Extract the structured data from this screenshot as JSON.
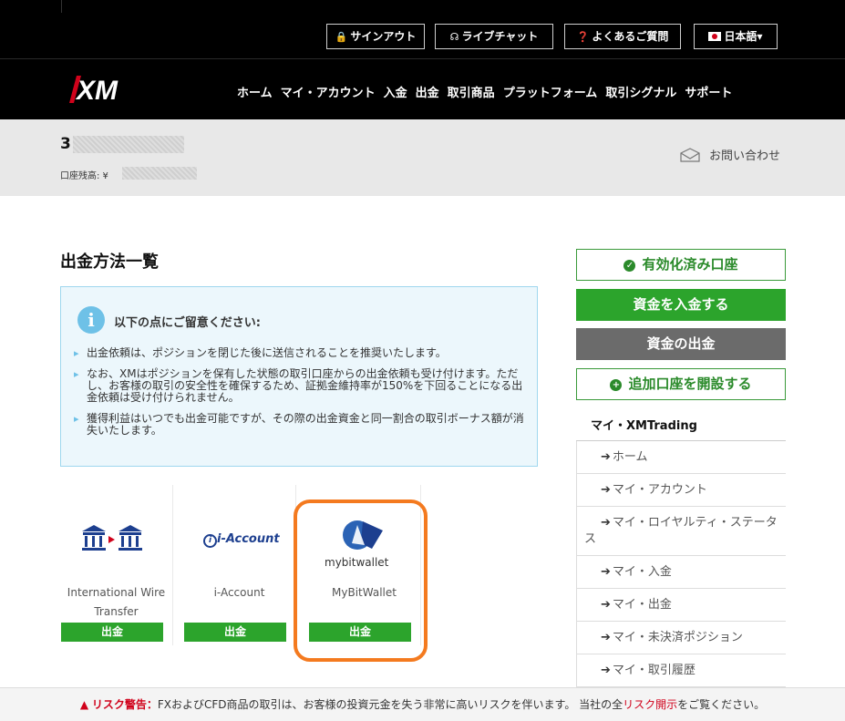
{
  "header": {
    "utility": {
      "signout": "サインアウト",
      "livechat": "ライブチャット",
      "faq": "よくあるご質問",
      "language": "日本語"
    },
    "logo": "XM",
    "nav": [
      "ホーム",
      "マイ・アカウント",
      "入金",
      "出金",
      "取引商品",
      "プラットフォーム",
      "取引シグナル",
      "サポート"
    ]
  },
  "account": {
    "number_prefix": "3",
    "balance_label": "口座残高: ¥",
    "contact": "お問い合わせ"
  },
  "page_title": "出金方法一覧",
  "notice": {
    "title": "以下の点にご留意ください:",
    "items": [
      "出金依頼は、ポジションを閉じた後に送信されることを推奨いたします。",
      "なお、XMはポジションを保有した状態の取引口座からの出金依頼も受け付けます。ただし、お客様の取引の安全性を確保するため、証拠金維持率が150%を下回ることになる出金依頼は受け付けられません。",
      "獲得利益はいつでも出金可能ですが、その際の出金資金と同一割合の取引ボーナス額が消失いたします。"
    ]
  },
  "methods": [
    {
      "name": "International Wire Transfer",
      "button": "出金",
      "logo_text": ""
    },
    {
      "name": "i-Account",
      "button": "出金",
      "logo_text": "i-Account"
    },
    {
      "name": "MyBitWallet",
      "button": "出金",
      "logo_text": "mybitwallet"
    }
  ],
  "sidebar": {
    "verified": "有効化済み口座",
    "deposit": "資金を入金する",
    "withdraw": "資金の出金",
    "open_account": "追加口座を開設する",
    "nav_heading": "マイ・XMTrading",
    "nav_items": [
      "ホーム",
      "マイ・アカウント",
      "マイ・ロイヤルティ・ステータス",
      "マイ・入金",
      "マイ・出金",
      "マイ・未決済ポジション",
      "マイ・取引履歴"
    ]
  },
  "risk": {
    "warning_label": "リスク警告：",
    "text_before": "FXおよびCFD商品の取引は、お客様の投資元金を失う非常に高いリスクを伴います。 当社の全",
    "link": "リスク開示",
    "text_after": "をご覧ください。"
  },
  "colors": {
    "green": "#2ca42c",
    "gray_button": "#6b6b6b",
    "highlight": "#f47a1f",
    "notice_bg": "#ecf7fc",
    "risk_red": "#d0021b"
  }
}
